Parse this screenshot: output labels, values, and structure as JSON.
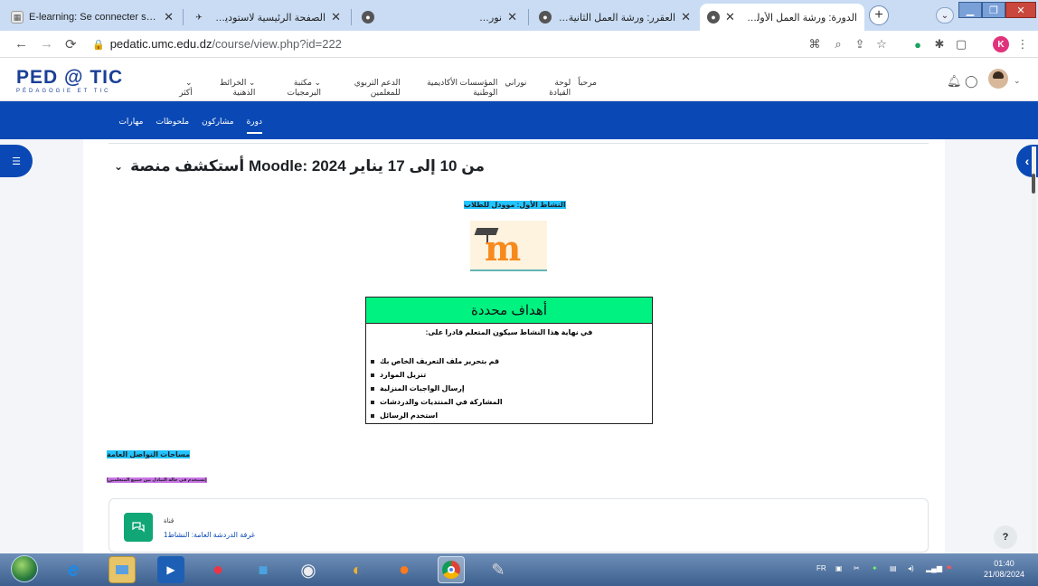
{
  "browser": {
    "tabs": [
      {
        "title": "E-learning: Se connecter sur le",
        "icon": "moodle-favicon"
      },
      {
        "title": "الصفحة الرئيسية لاستوديو T - Studio",
        "icon": "studio-favicon"
      },
      {
        "title": "",
        "icon": "globe-favicon"
      },
      {
        "title": "نوراني",
        "icon": "globe-favicon"
      },
      {
        "title": "العقرر: ورشة العمل الثانية: تصميم مقرر",
        "icon": "globe-favicon"
      },
      {
        "title": "الدورة: ورشة العمل الأولى: أدوات لند",
        "icon": "globe-favicon",
        "active": true
      }
    ],
    "url_host": "pedatic.umc.edu.dz",
    "url_path": "/course/view.php?id=222",
    "profile_initial": "K"
  },
  "site": {
    "logo_main": "PED @ TIC",
    "logo_sub": "PÉDAGOGIE ET TIC",
    "primary_nav": [
      "مرحباً",
      "لوحة القيادة",
      "نوراني",
      "المؤسسات الأكاديمية الوطنية",
      "الدعم التربوي للمعلمين",
      "⌄ مكتبة البرمجيات",
      "⌄ الخرائط الذهنية",
      "⌄ أكثر"
    ]
  },
  "secondary_nav": [
    "دورة",
    "مشاركون",
    "ملحوظات",
    "مهارات"
  ],
  "section": {
    "title": "من 10 إلى 17 يناير 2024 :Moodle أستكشف منصة"
  },
  "activity_label": "النشاط الأول: موودل للطلاب",
  "objectives": {
    "heading": "أهداف محددة",
    "intro": "في نهاية هذا النشاط سيكون المتعلم قادرا على:",
    "items": [
      "قم بتحرير ملف التعريف الخاص بك",
      "تنزيل الموارد",
      "إرسال الواجبات المنزلية",
      "المشاركة في المنتديات والدردشات",
      "استخدم الرسائل"
    ]
  },
  "comm_title": "مساحات التواصل العامة",
  "comm_sub": "(تستخدم في حالة التبادل بين جميع المتعلمين)",
  "forum_card": {
    "type": "قناة",
    "name": "غرفة الدردشة العامة: النشاط1"
  },
  "help_label": "?",
  "taskbar": {
    "lang": "FR",
    "time": "01:40",
    "date": "21/08/2024"
  },
  "colors": {
    "brand_blue": "#0a49b5",
    "objectives_header": "#00f280",
    "highlight_cyan": "#22c4ff",
    "highlight_purple": "#c974e6",
    "forum_green": "#11a676"
  }
}
